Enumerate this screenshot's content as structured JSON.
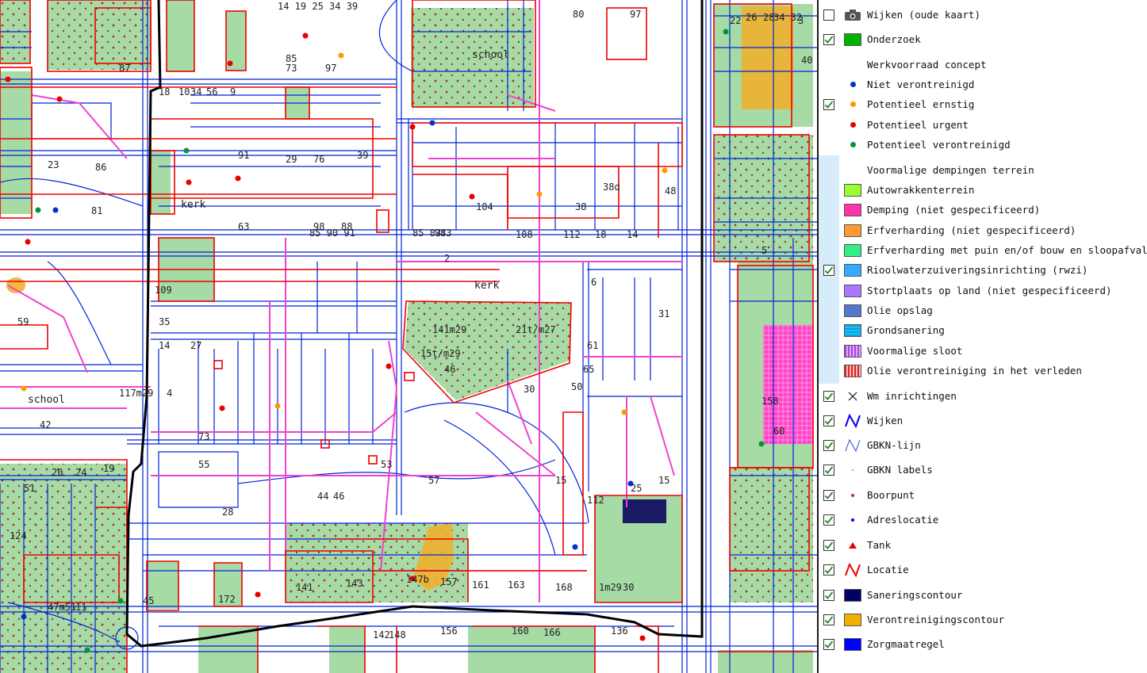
{
  "map": {
    "labels": {
      "school_top": "school",
      "school_left": "school",
      "kerk_left": "kerk",
      "kerk_center": "kerk"
    },
    "street_numbers": [
      "14 19 25 34 39",
      "80",
      "97",
      "22",
      "28",
      "26",
      "34 32",
      "3",
      "40",
      "87",
      "73",
      "18",
      "10",
      "34",
      "56",
      "9",
      "97",
      "85",
      "91",
      "76",
      "29",
      "39",
      "23",
      "86",
      "81",
      "63",
      "98",
      "88",
      "104",
      "108",
      "112",
      "18",
      "14",
      "94",
      "38d",
      "38",
      "48",
      "59",
      "85 90 91",
      "85 83",
      "83",
      "2",
      "141m29",
      "21t/m27",
      "15t/m29",
      "109",
      "35",
      "46",
      "30",
      "50",
      "61",
      "65",
      "6",
      "31",
      "42",
      "14",
      "27",
      "73",
      "55",
      "53",
      "57",
      "15",
      "20",
      "24",
      "19",
      "51",
      "112",
      "15",
      "25",
      "28",
      "44",
      "46",
      "141",
      "143",
      "147b",
      "157",
      "161",
      "163",
      "168",
      "1m29",
      "47m51",
      "45",
      "172",
      "142",
      "148",
      "156",
      "160",
      "166",
      "136",
      "124",
      "11",
      "117m29",
      "4",
      "5",
      "30",
      "158",
      "60",
      "48"
    ]
  },
  "legend": {
    "items": [
      {
        "id": "wijken-oude-kaart",
        "label": "Wijken (oude kaart)",
        "checked": false,
        "symbol": "camera-icon"
      },
      {
        "id": "onderzoek",
        "label": "Onderzoek",
        "checked": true,
        "symbol": "swatch",
        "color": "#00b300"
      },
      {
        "id": "werkvoorraad-header",
        "label": "Werkvoorraad concept",
        "checked": null,
        "symbol": "none"
      },
      {
        "id": "niet-verontreinigd",
        "label": "Niet verontreinigd",
        "checked": null,
        "symbol": "dot",
        "color": "#0033cc"
      },
      {
        "id": "potentieel-ernstig",
        "label": "Potentieel ernstig",
        "checked": true,
        "symbol": "dot",
        "color": "#ff9900"
      },
      {
        "id": "potentieel-urgent",
        "label": "Potentieel urgent",
        "checked": null,
        "symbol": "dot",
        "color": "#e60000"
      },
      {
        "id": "potentieel-verontreinigd",
        "label": "Potentieel verontreinigd",
        "checked": null,
        "symbol": "dot",
        "color": "#009933"
      },
      {
        "id": "dempingen-header",
        "label": "Voormalige dempingen terrein",
        "checked": null,
        "symbol": "none"
      },
      {
        "id": "autowrakkenterrein",
        "label": "Autowrakkenterrein",
        "checked": null,
        "symbol": "swatch",
        "color": "#99ff33"
      },
      {
        "id": "demping",
        "label": "Demping (niet gespecificeerd)",
        "checked": null,
        "symbol": "swatch",
        "color": "#ff33aa"
      },
      {
        "id": "erfverharding",
        "label": "Erfverharding (niet gespecificeerd)",
        "checked": null,
        "symbol": "swatch",
        "color": "#ff9933"
      },
      {
        "id": "erfverharding-puin",
        "label": "Erfverharding met puin en/of bouw en sloopafval",
        "checked": null,
        "symbol": "swatch",
        "color": "#33ee88"
      },
      {
        "id": "rwzi",
        "label": "Rioolwaterzuiveringsinrichting (rwzi)",
        "checked": true,
        "symbol": "swatch",
        "color": "#33aaff"
      },
      {
        "id": "stortplaats",
        "label": "Stortplaats op land (niet gespecificeerd)",
        "checked": null,
        "symbol": "swatch",
        "color": "#aa77ff"
      },
      {
        "id": "olie-opslag",
        "label": "Olie opslag",
        "checked": null,
        "symbol": "swatch",
        "color": "#5577cc"
      },
      {
        "id": "grondsanering",
        "label": "Grondsanering",
        "checked": null,
        "symbol": "hatch-cyan"
      },
      {
        "id": "voormalige-sloot",
        "label": "Voormalige sloot",
        "checked": null,
        "symbol": "hatch-purple"
      },
      {
        "id": "olie-verleden",
        "label": "Olie verontreiniging in het verleden",
        "checked": null,
        "symbol": "hatch-red"
      },
      {
        "id": "wm-inrichtingen",
        "label": "Wm inrichtingen",
        "checked": true,
        "symbol": "cross-icon"
      },
      {
        "id": "wijken",
        "label": "Wijken",
        "checked": true,
        "symbol": "line-icon",
        "color": "#0000ee"
      },
      {
        "id": "gbkn-lijn",
        "label": "GBKN-lijn",
        "checked": true,
        "symbol": "thin-line-icon",
        "color": "#3344dd"
      },
      {
        "id": "gbkn-labels",
        "label": "GBKN labels",
        "checked": true,
        "symbol": "tiny-dot",
        "color": "#888888"
      },
      {
        "id": "boorpunt",
        "label": "Boorpunt",
        "checked": true,
        "symbol": "small-dot",
        "color": "#aa3333"
      },
      {
        "id": "adreslocatie",
        "label": "Adreslocatie",
        "checked": true,
        "symbol": "small-dot",
        "color": "#0000ee"
      },
      {
        "id": "tank",
        "label": "Tank",
        "checked": true,
        "symbol": "triangle-icon",
        "color": "#ee0000"
      },
      {
        "id": "locatie",
        "label": "Locatie",
        "checked": true,
        "symbol": "line-icon",
        "color": "#ee0000"
      },
      {
        "id": "saneringscontour",
        "label": "Saneringscontour",
        "checked": true,
        "symbol": "swatch",
        "color": "#000066"
      },
      {
        "id": "verontreinigingscontour",
        "label": "Verontreinigingscontour",
        "checked": true,
        "symbol": "swatch",
        "color": "#f0b000"
      },
      {
        "id": "zorgmaatregel",
        "label": "Zorgmaatregel",
        "checked": true,
        "symbol": "swatch",
        "color": "#0000ff"
      }
    ]
  },
  "colors": {
    "gbkn": "#0022dd",
    "locatie": "#ee0000",
    "onderzoek_fill": "#a6dba6",
    "contour_orange": "#f0b030",
    "demping_pink": "#ff33bb",
    "sanering_navy": "#1a1a66",
    "wijk_border": "#000000",
    "pipe_magenta": "#ee44cc"
  }
}
